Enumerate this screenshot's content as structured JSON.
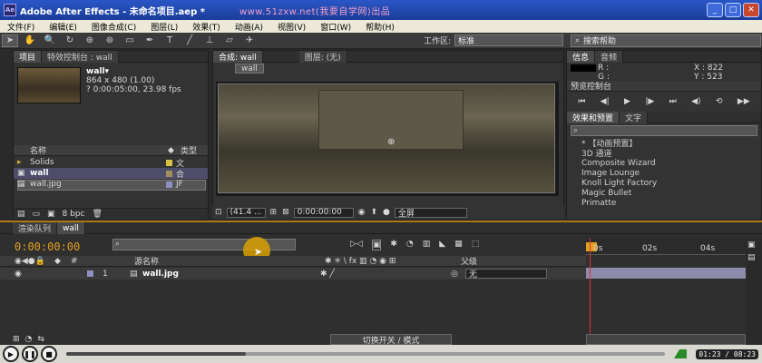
{
  "window": {
    "app_icon": "Ae",
    "title": "Adobe After Effects - 未命名项目.aep *",
    "watermark": "www.51zxw.net(我要自学网)出品"
  },
  "menu": [
    "文件(F)",
    "编辑(E)",
    "图像合成(C)",
    "图层(L)",
    "效果(T)",
    "动画(A)",
    "视图(V)",
    "窗口(W)",
    "帮助(H)"
  ],
  "toolbar": {
    "workspace_label": "工作区:",
    "workspace_value": "标准",
    "search_placeholder": "搜索帮助"
  },
  "project": {
    "tabs": [
      "项目",
      "特效控制台 : wall"
    ],
    "item_name": "wall▾",
    "item_size": "864 x 480 (1.00)",
    "item_duration": "? 0:00:05:00, 23.98 fps",
    "columns": [
      "名称",
      "类型"
    ],
    "rows": [
      {
        "name": "Solids",
        "type": "文",
        "color": "#d8c040"
      },
      {
        "name": "wall",
        "type": "合",
        "color": "#a09060"
      },
      {
        "name": "wall.jpg",
        "type": "JF",
        "color": "#9090c0"
      }
    ],
    "bpc": "8 bpc"
  },
  "comp": {
    "tab": "合成: wall",
    "layer_tab": "图层: (无)",
    "sub_tab": "wall",
    "zoom": "(41.4 ...",
    "timecode": "0:00:00:00",
    "resolution": "全屏"
  },
  "info": {
    "tabs": [
      "信息",
      "音频"
    ],
    "r": "R :",
    "g": "G :",
    "x": "X : 822",
    "y": "Y : 523"
  },
  "preview": {
    "title": "预览控制台"
  },
  "effects": {
    "tabs": [
      "效果和预置",
      "文字"
    ],
    "items": [
      "* 【动画预置】",
      "3D 通道",
      "Composite Wizard",
      "Image Lounge",
      "Knoll Light Factory",
      "Magic Bullet",
      "Primatte"
    ]
  },
  "timeline": {
    "tabs": [
      "渲染队列",
      "wall"
    ],
    "time": "0:00:00:00",
    "col_source": "源名称",
    "col_parent": "父级",
    "layer": {
      "index": "1",
      "name": "wall.jpg",
      "parent": "无"
    },
    "ruler": [
      "0s",
      "02s",
      "04s"
    ],
    "mode_label": "切换开关 / 模式"
  },
  "player": {
    "time": "01:23 / 08:23",
    "progress": 0.3
  }
}
